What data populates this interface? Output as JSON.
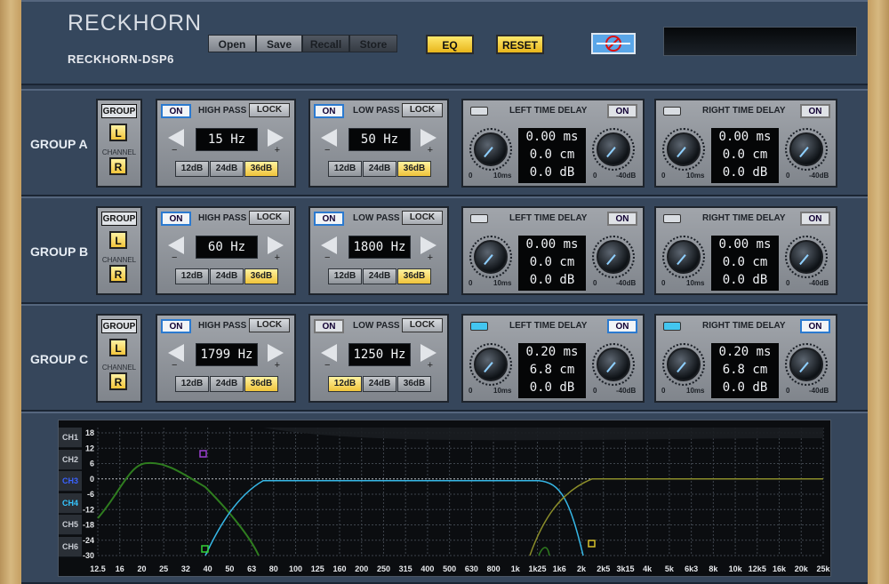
{
  "brand": "RECKHORN",
  "model": "RECKHORN-DSP6",
  "toolbar": {
    "open": "Open",
    "save": "Save",
    "recall": "Recall",
    "store": "Store",
    "eq": "EQ",
    "reset": "RESET"
  },
  "groups": [
    {
      "label": "GROUP A",
      "group_btn": "GROUP",
      "channel": "CHANNEL",
      "l": "L",
      "r": "R",
      "hp": {
        "on": "ON",
        "title": "HIGH PASS",
        "lock": "LOCK",
        "freq": "15 Hz"
      },
      "lp": {
        "on": "ON",
        "title": "LOW PASS",
        "lock": "LOCK",
        "freq": "50 Hz"
      },
      "ltd": {
        "on": "ON",
        "title": "LEFT TIME DELAY",
        "ms": "0.00 ms",
        "cm": "0.0 cm",
        "db": "0.0 dB"
      },
      "rtd": {
        "on": "ON",
        "title": "RIGHT TIME DELAY",
        "ms": "0.00 ms",
        "cm": "0.0 cm",
        "db": "0.0 dB"
      }
    },
    {
      "label": "GROUP B",
      "group_btn": "GROUP",
      "channel": "CHANNEL",
      "l": "L",
      "r": "R",
      "hp": {
        "on": "ON",
        "title": "HIGH PASS",
        "lock": "LOCK",
        "freq": "60 Hz"
      },
      "lp": {
        "on": "ON",
        "title": "LOW PASS",
        "lock": "LOCK",
        "freq": "1800 Hz"
      },
      "ltd": {
        "on": "ON",
        "title": "LEFT  TIME DELAY",
        "ms": "0.00 ms",
        "cm": "0.0 cm",
        "db": "0.0 dB"
      },
      "rtd": {
        "on": "ON",
        "title": "RIGHT TIME DELAY",
        "ms": "0.00 ms",
        "cm": "0.0 cm",
        "db": "0.0 dB"
      }
    },
    {
      "label": "GROUP C",
      "group_btn": "GROUP",
      "channel": "CHANNEL",
      "l": "L",
      "r": "R",
      "hp": {
        "on": "ON",
        "title": "HIGH PASS",
        "lock": "LOCK",
        "freq": "1799 Hz"
      },
      "lp": {
        "on": "ON",
        "title": "LOW PASS",
        "lock": "LOCK",
        "freq": "1250 Hz"
      },
      "ltd": {
        "on": "ON",
        "title": "LEFT  TIME DELAY",
        "ms": "0.20 ms",
        "cm": "6.8 cm",
        "db": "0.0 dB"
      },
      "rtd": {
        "on": "ON",
        "title": "RIGHT TIME DELAY",
        "ms": "0.20 ms",
        "cm": "6.8 cm",
        "db": "0.0 dB"
      }
    }
  ],
  "slopes": [
    "12dB",
    "24dB",
    "36dB"
  ],
  "delay_scale": {
    "min": "0",
    "max": "10ms"
  },
  "gain_scale": {
    "min": "0",
    "max": "-40dB"
  },
  "signs": {
    "minus": "−",
    "plus": "+"
  },
  "channels": [
    "CH1",
    "CH2",
    "CH3",
    "CH4",
    "CH5",
    "CH6"
  ],
  "graph": {
    "y_ticks": [
      "18",
      "12",
      "6",
      "0",
      "-6",
      "-12",
      "-18",
      "-24",
      "-30"
    ],
    "x_ticks": [
      "12.5",
      "16",
      "20",
      "25",
      "32",
      "40",
      "50",
      "63",
      "80",
      "100",
      "125",
      "160",
      "200",
      "250",
      "315",
      "400",
      "500",
      "630",
      "800",
      "1k",
      "1k25",
      "1k6",
      "2k",
      "2k5",
      "3k15",
      "4k",
      "5k",
      "6k3",
      "8k",
      "10k",
      "12k5",
      "16k",
      "20k",
      "25k"
    ],
    "colors": {
      "ch2": "#2f7d1f",
      "ch4": "#36b7e6",
      "ch_olive": "#8b8d2a"
    }
  }
}
